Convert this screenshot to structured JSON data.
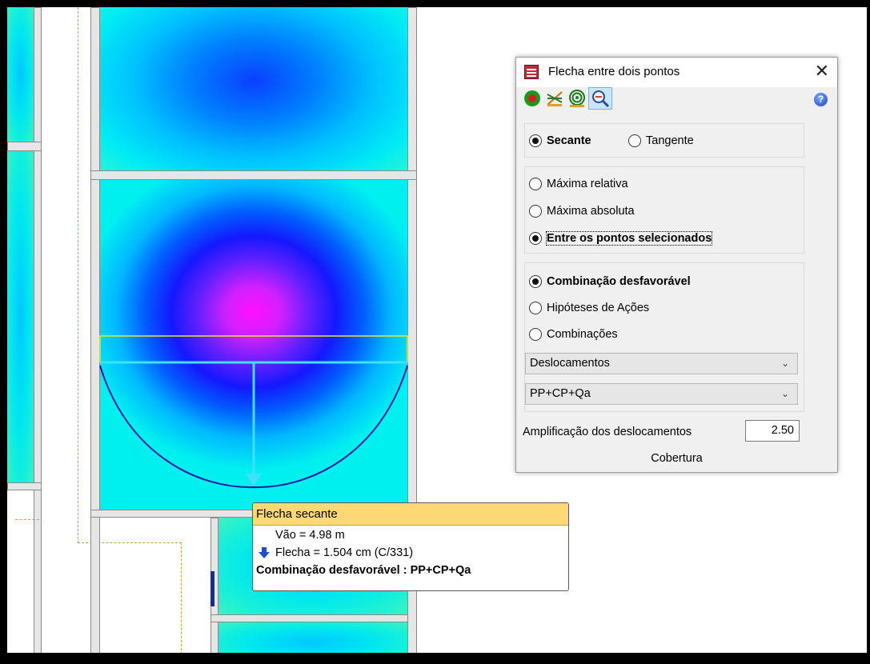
{
  "dialog": {
    "title": "Flecha entre dois pontos",
    "close_label": "✕",
    "help_label": "?",
    "type_options": [
      {
        "label": "Secante",
        "checked": true
      },
      {
        "label": "Tangente",
        "checked": false
      }
    ],
    "mode_options": [
      {
        "label": "Máxima relativa",
        "checked": false
      },
      {
        "label": "Máxima absoluta",
        "checked": false
      },
      {
        "label": "Entre os pontos selecionados",
        "checked": true
      }
    ],
    "combo_options": [
      {
        "label": "Combinação desfavorável",
        "checked": true
      },
      {
        "label": "Hipóteses de Ações",
        "checked": false
      },
      {
        "label": "Combinações",
        "checked": false
      }
    ],
    "result_select": "Deslocamentos",
    "combination_select": "PP+CP+Qa",
    "amplification_label": "Amplificação dos deslocamentos",
    "amplification_value": "2.50",
    "footer": "Cobertura"
  },
  "tooltip": {
    "title": "Flecha secante",
    "span": "Vão = 4.98 m",
    "deflection": "Flecha = 1.504 cm (C/331)",
    "combination": "Combinação desfavorável : PP+CP+Qa"
  },
  "colors": {
    "dialog_bg": "#f0f0f0",
    "tooltip_header": "#ffd876",
    "deflection_curve": "#1a1aa0",
    "span_line": "#40e0ff",
    "highlight_line": "#e8e830"
  },
  "icons": [
    "app-icon",
    "close-icon",
    "view-color-icon",
    "deformed-shape-icon",
    "contour-icon",
    "zoom-select-icon",
    "help-icon",
    "arrow-down-icon",
    "chevron-down-icon"
  ]
}
